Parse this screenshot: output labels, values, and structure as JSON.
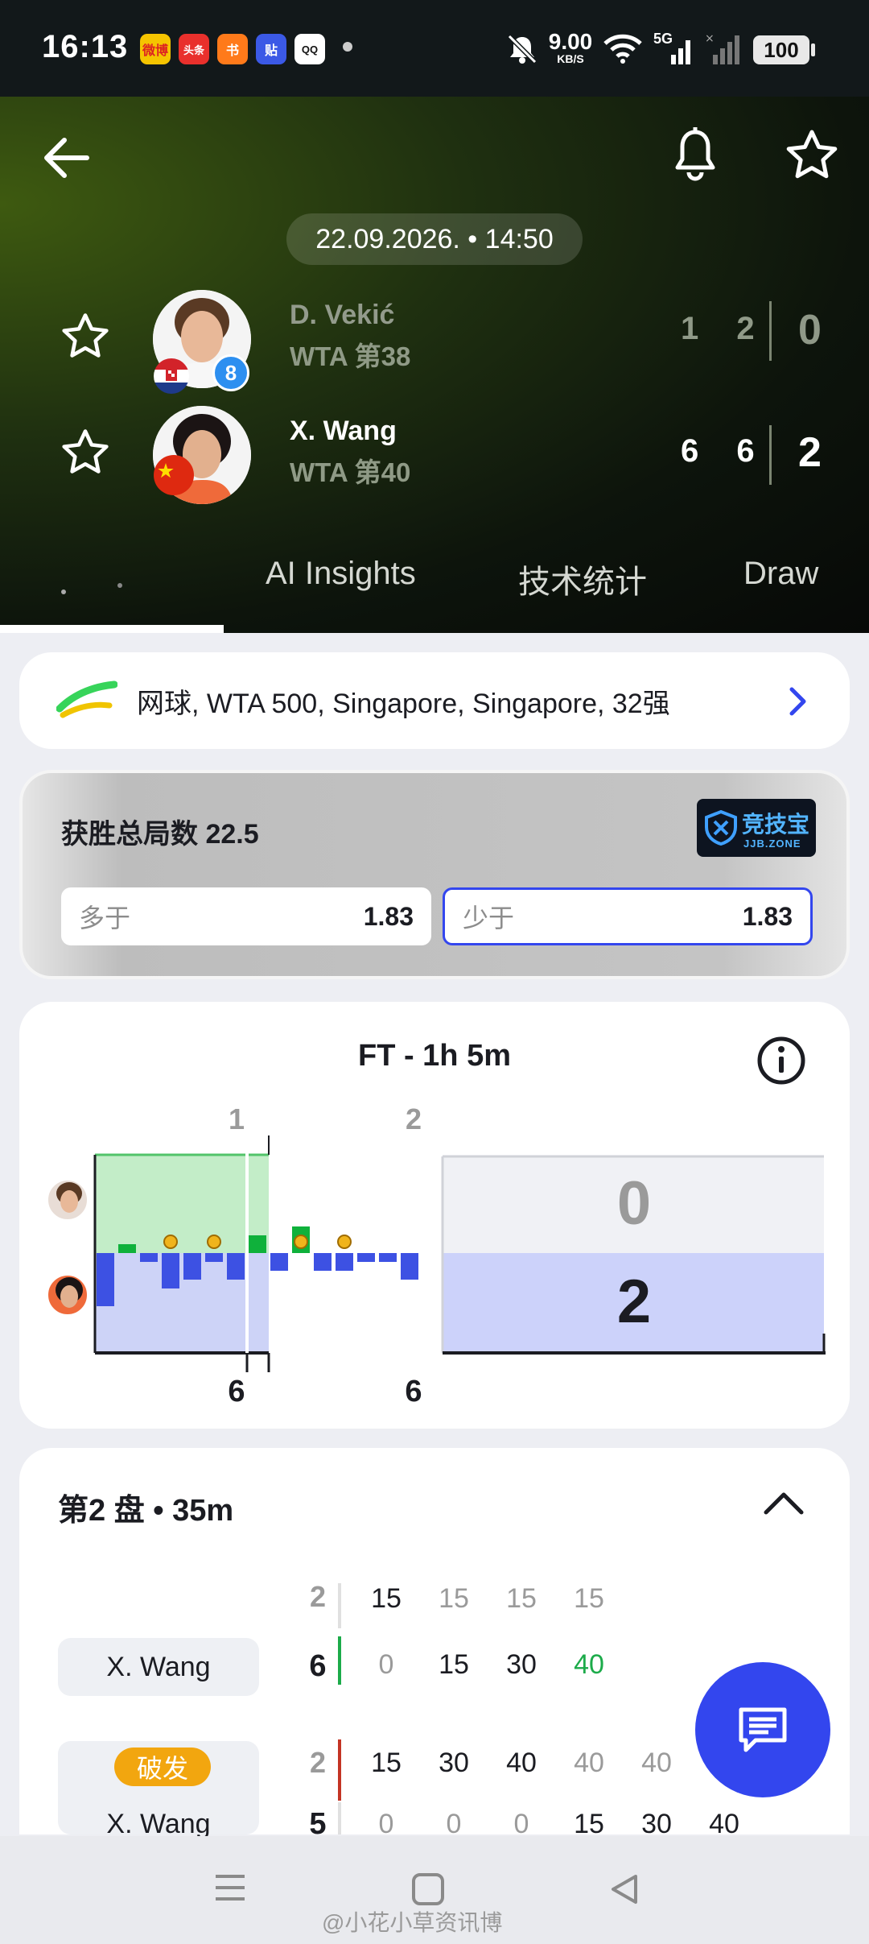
{
  "status_bar": {
    "time": "16:13",
    "net_speed_value": "9.00",
    "net_speed_unit": "KB/S",
    "network": "5G",
    "battery": "100",
    "apps": [
      "微博",
      "头条",
      "书",
      "贴",
      "QQ"
    ]
  },
  "header": {
    "date": "22.09.2026. • 14:50",
    "icons": [
      "back-arrow-icon",
      "bell-icon",
      "star-icon"
    ]
  },
  "players": [
    {
      "name": "D. Vekić",
      "rank": "WTA 第38",
      "seed": "8",
      "sets": "1 2",
      "total": "0",
      "flag": "croatia"
    },
    {
      "name": "X. Wang",
      "rank": "WTA 第40",
      "sets": "6 6",
      "total": "2",
      "flag": "china"
    }
  ],
  "tabs": [
    "AI Insights",
    "技术统计",
    "Draw"
  ],
  "competition": {
    "text": "网球, WTA 500, Singapore, Singapore, 32强"
  },
  "odds": {
    "title": "获胜总局数 22.5",
    "logo_text": "竞技宝",
    "logo_sub": "JJB.ZONE",
    "over_label": "多于",
    "over_value": "1.83",
    "under_label": "少于",
    "under_value": "1.83"
  },
  "momentum": {
    "title": "FT - 1h 5m",
    "set_labels": [
      "1",
      "2"
    ],
    "bottom_scores": [
      "6",
      "6"
    ],
    "top_set_score": "0",
    "bottom_set_score": "2",
    "bars": [
      -6,
      1,
      -1,
      -4,
      -3,
      -1,
      -3,
      2,
      -2,
      3,
      -2,
      -2,
      -1,
      -1,
      -3
    ],
    "serve_markers": [
      3,
      5,
      9,
      11
    ]
  },
  "set_detail": {
    "title": "第2 盘 • 35m",
    "rows": [
      {
        "tag": "X. Wang",
        "opp_score": "2",
        "score": "6",
        "top": [
          "15",
          "15",
          "15",
          "15"
        ],
        "bottom": [
          "0",
          "15",
          "30",
          "40"
        ]
      },
      {
        "badge": "破发",
        "tag": "X. Wang",
        "opp_score": "2",
        "score": "5",
        "top": [
          "15",
          "30",
          "40",
          "40",
          "40"
        ],
        "bottom": [
          "0",
          "0",
          "0",
          "15",
          "30",
          "40"
        ]
      }
    ]
  },
  "watermark": "@小花小草资讯博",
  "colors": {
    "accent": "#3346ee",
    "green_bar": "#0fb13b",
    "blue_bar": "#3d51e3",
    "break_badge": "#f2a60f"
  }
}
